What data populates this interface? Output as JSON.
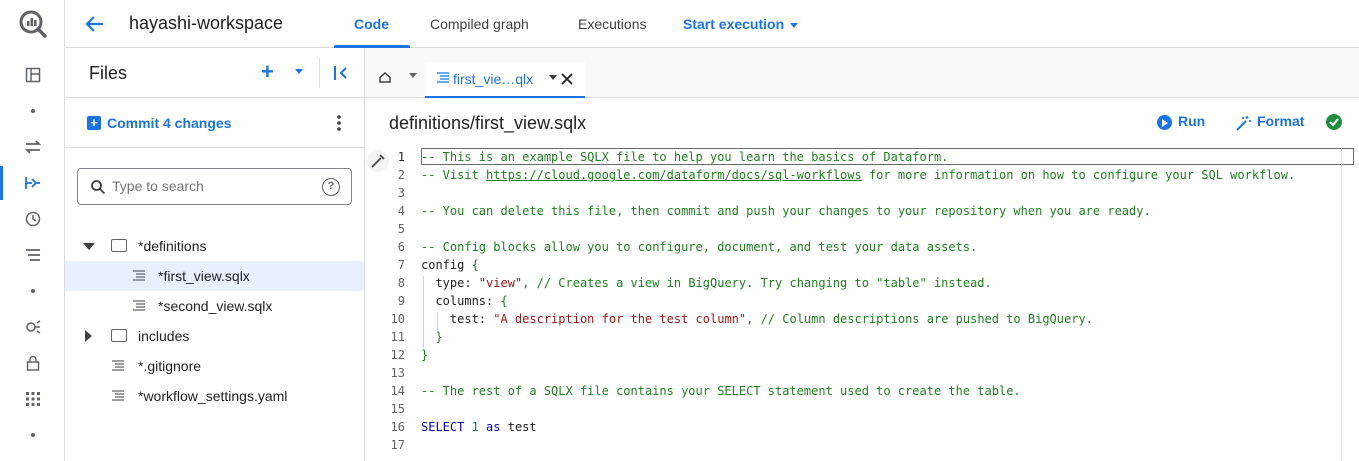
{
  "app": {
    "workspace_title": "hayashi-workspace"
  },
  "topnav": {
    "tabs": [
      {
        "label": "Code",
        "active": true
      },
      {
        "label": "Compiled graph",
        "active": false
      },
      {
        "label": "Executions",
        "active": false
      }
    ],
    "start_execution": "Start execution"
  },
  "rail": {
    "icons": [
      "bigquery-logo-icon",
      "explorer-icon",
      "transfers-icon",
      "dataform-icon",
      "scheduled-queries-icon",
      "query-history-icon",
      "analytics-hub-icon",
      "policy-tags-icon",
      "more-apps-icon"
    ]
  },
  "files_panel": {
    "title": "Files",
    "commit_label": "Commit 4 changes",
    "search_placeholder": "Type to search",
    "tree": [
      {
        "label": "*definitions",
        "type": "folder",
        "expanded": true
      },
      {
        "label": "*first_view.sqlx",
        "type": "file",
        "selected": true
      },
      {
        "label": "*second_view.sqlx",
        "type": "file"
      },
      {
        "label": "includes",
        "type": "folder",
        "expanded": false
      },
      {
        "label": "*.gitignore",
        "type": "file"
      },
      {
        "label": "*workflow_settings.yaml",
        "type": "file"
      }
    ]
  },
  "editor": {
    "tab_label": "first_vie…qlx",
    "path": "definitions/first_view.sqlx",
    "run_label": "Run",
    "format_label": "Format",
    "line_numbers": [
      "1",
      "2",
      "3",
      "4",
      "5",
      "6",
      "7",
      "8",
      "9",
      "10",
      "11",
      "12",
      "13",
      "14",
      "15",
      "16",
      "17"
    ],
    "code": {
      "l1": "-- This is an example SQLX file to help you learn the basics of Dataform.",
      "l2a": "-- Visit ",
      "l2b": "https://cloud.google.com/dataform/docs/sql-workflows",
      "l2c": " for more information on how to configure your SQL workflow.",
      "l4": "-- You can delete this file, then commit and push your changes to your repository when you are ready.",
      "l6": "-- Config blocks allow you to configure, document, and test your data assets.",
      "l7a": "config",
      "l7b": " {",
      "l8a": "  type: ",
      "l8b": "\"view\"",
      "l8c": ", // Creates a view in BigQuery. Try changing to \"table\" instead.",
      "l9a": "  columns: ",
      "l9b": "{",
      "l10a": "    test: ",
      "l10b": "\"A description for the test column\"",
      "l10c": ", // Column descriptions are pushed to BigQuery.",
      "l11": "  }",
      "l12": "}",
      "l14": "-- The rest of a SQLX file contains your SELECT statement used to create the table.",
      "l16a": "SELECT",
      "l16b": " 1",
      "l16c": " as",
      "l16d": " test"
    }
  }
}
